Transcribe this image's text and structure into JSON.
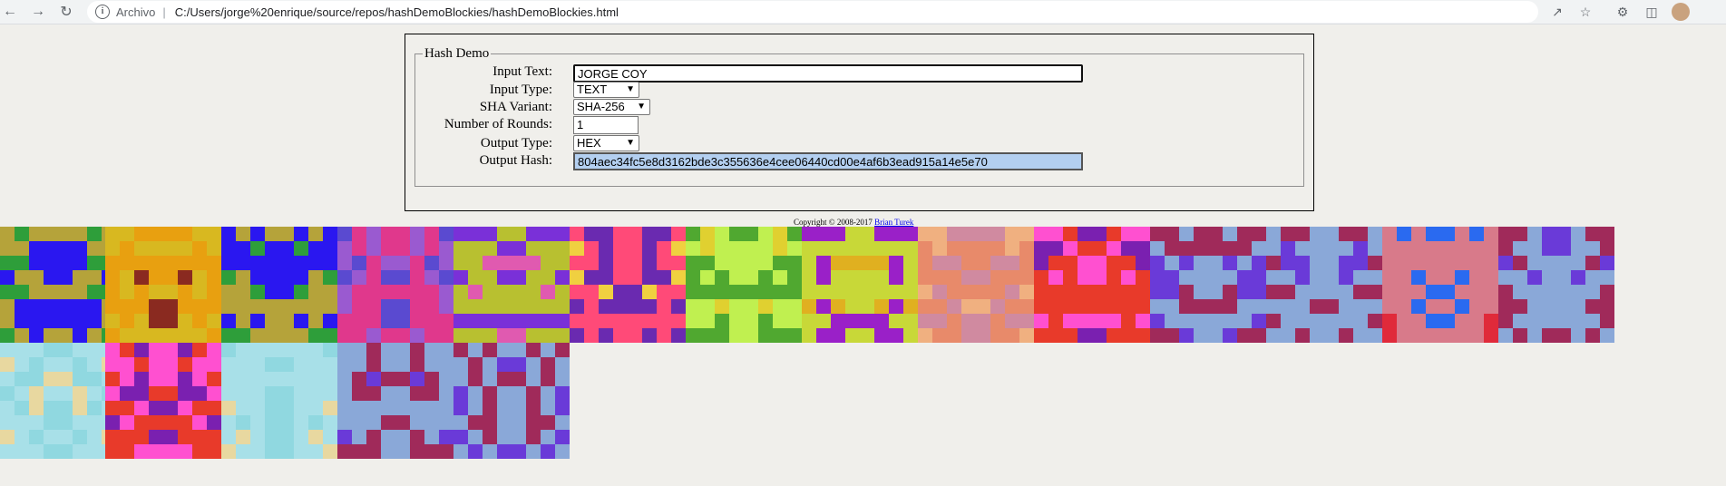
{
  "browser": {
    "scheme_label": "Archivo",
    "url": "C:/Users/jorge%20enrique/source/repos/hashDemoBlockies/hashDemoBlockies.html",
    "icons": [
      "back-icon",
      "forward-icon",
      "reload-icon",
      "info-icon",
      "share-icon",
      "star-icon",
      "extensions-icon",
      "side-panel-icon",
      "avatar"
    ]
  },
  "form": {
    "legend": "Hash Demo",
    "input_text_label": "Input Text:",
    "input_text_value": "JORGE COY",
    "input_type_label": "Input Type:",
    "input_type_value": "TEXT",
    "sha_variant_label": "SHA Variant:",
    "sha_variant_value": "SHA-256",
    "rounds_label": "Number of Rounds:",
    "rounds_value": "1",
    "output_type_label": "Output Type:",
    "output_type_value": "HEX",
    "output_hash_label": "Output Hash:",
    "output_hash_value": "804aec34fc5e8d3162bde3c355636e4cee06440cd00e4af6b3ead915a14e5e70"
  },
  "footer": {
    "copyright_prefix": "Copyright © 2008-2017",
    "author_link": "Brian Turek"
  },
  "blockies": {
    "count": 19,
    "palettes": [
      {
        "bg": "#2a17f0",
        "fg": "#b5a33a",
        "spot": "#2e9e3a"
      },
      {
        "bg": "#e8a010",
        "fg": "#d8b820",
        "spot": "#8a2a20"
      },
      {
        "bg": "#2a17f0",
        "fg": "#b5a33a",
        "spot": "#2e9e3a"
      },
      {
        "bg": "#e0388c",
        "fg": "#9a5ad0",
        "spot": "#5a4ad0"
      },
      {
        "bg": "#b8c030",
        "fg": "#7a30d8",
        "spot": "#e05ab0"
      },
      {
        "bg": "#ff4a78",
        "fg": "#6a2ab0",
        "spot": "#f0d040"
      },
      {
        "bg": "#c0f050",
        "fg": "#50a830",
        "spot": "#e0d030"
      },
      {
        "bg": "#c8d838",
        "fg": "#9a20c8",
        "spot": "#e0b020"
      },
      {
        "bg": "#e88a6a",
        "fg": "#d08aa0",
        "spot": "#f0b080"
      },
      {
        "bg": "#e83a2a",
        "fg": "#ff50d0",
        "spot": "#7a20b0"
      },
      {
        "bg": "#8aa8d8",
        "fg": "#a02a5a",
        "spot": "#6a3ad8"
      },
      {
        "bg": "#8aa8d8",
        "fg": "#a02a5a",
        "spot": "#6a3ad8"
      },
      {
        "bg": "#d87a8a",
        "fg": "#2a6af0",
        "spot": "#e02a3a"
      },
      {
        "bg": "#8aa8d8",
        "fg": "#a02a5a",
        "spot": "#6a3ad8"
      },
      {
        "bg": "#a8e0e8",
        "fg": "#90d8e0",
        "spot": "#e8d8a0"
      },
      {
        "bg": "#e83a2a",
        "fg": "#ff50d0",
        "spot": "#7a20b0"
      },
      {
        "bg": "#a8e0e8",
        "fg": "#90d8e0",
        "spot": "#e8d8a0"
      },
      {
        "bg": "#8aa8d8",
        "fg": "#a02a5a",
        "spot": "#6a3ad8"
      },
      {
        "bg": "#8aa8d8",
        "fg": "#a02a5a",
        "spot": "#6a3ad8"
      }
    ]
  }
}
